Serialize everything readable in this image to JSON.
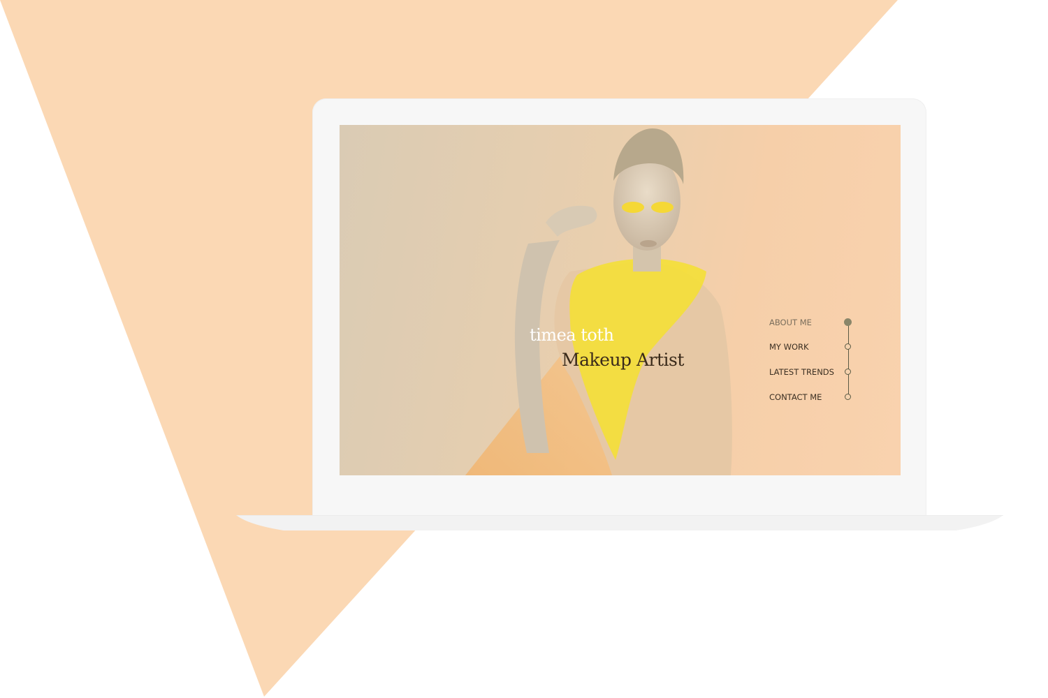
{
  "colors": {
    "accent_peach": "#fbd8b4",
    "nav_active": "#8a866a",
    "scarf_yellow": "#f5e030"
  },
  "hero": {
    "name": "timea toth",
    "title": "Makeup Artist"
  },
  "nav": {
    "items": [
      {
        "label": "ABOUT ME",
        "active": true
      },
      {
        "label": "MY WORK",
        "active": false
      },
      {
        "label": "LATEST TRENDS",
        "active": false
      },
      {
        "label": "CONTACT ME",
        "active": false
      }
    ]
  },
  "icons": [
    "nav-dot-icon"
  ]
}
